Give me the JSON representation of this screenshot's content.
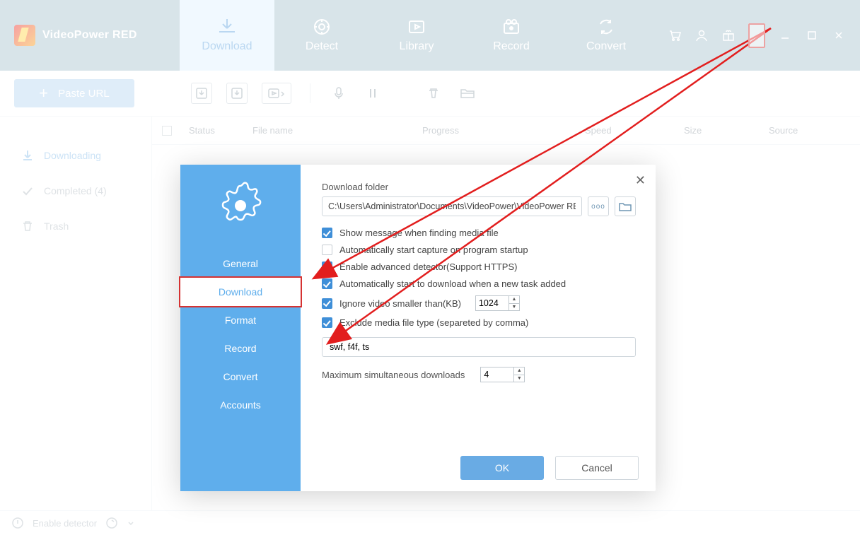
{
  "brand": {
    "title": "VideoPower RED"
  },
  "topTabs": {
    "download": "Download",
    "detect": "Detect",
    "library": "Library",
    "record": "Record",
    "convert": "Convert"
  },
  "toolbar": {
    "pasteUrl": "Paste URL"
  },
  "sidebar": {
    "downloading": "Downloading",
    "completed": "Completed (4)",
    "trash": "Trash"
  },
  "columns": {
    "status": "Status",
    "filename": "File name",
    "progress": "Progress",
    "speed": "Speed",
    "size": "Size",
    "source": "Source"
  },
  "footer": {
    "enableDetector": "Enable detector"
  },
  "settings": {
    "sideTabs": {
      "general": "General",
      "download": "Download",
      "format": "Format",
      "record": "Record",
      "convert": "Convert",
      "accounts": "Accounts"
    },
    "downloadFolderLabel": "Download folder",
    "downloadFolderPath": "C:\\Users\\Administrator\\Documents\\VideoPower\\VideoPower RED\\",
    "opts": {
      "showMsg": "Show message when finding media file",
      "autoStartCap": "Automatically start capture on program startup",
      "enableAdv": "Enable advanced detector(Support HTTPS)",
      "autoDownload": "Automatically start to download when a new task added",
      "ignoreSmaller": "Ignore video smaller than(KB)",
      "excludeTypes": "Exclude media file type (separeted by comma)"
    },
    "ignoreKB": "1024",
    "excludeValue": "swf, f4f, ts",
    "maxSimLabel": "Maximum simultaneous downloads",
    "maxSimValue": "4",
    "ok": "OK",
    "cancel": "Cancel"
  }
}
